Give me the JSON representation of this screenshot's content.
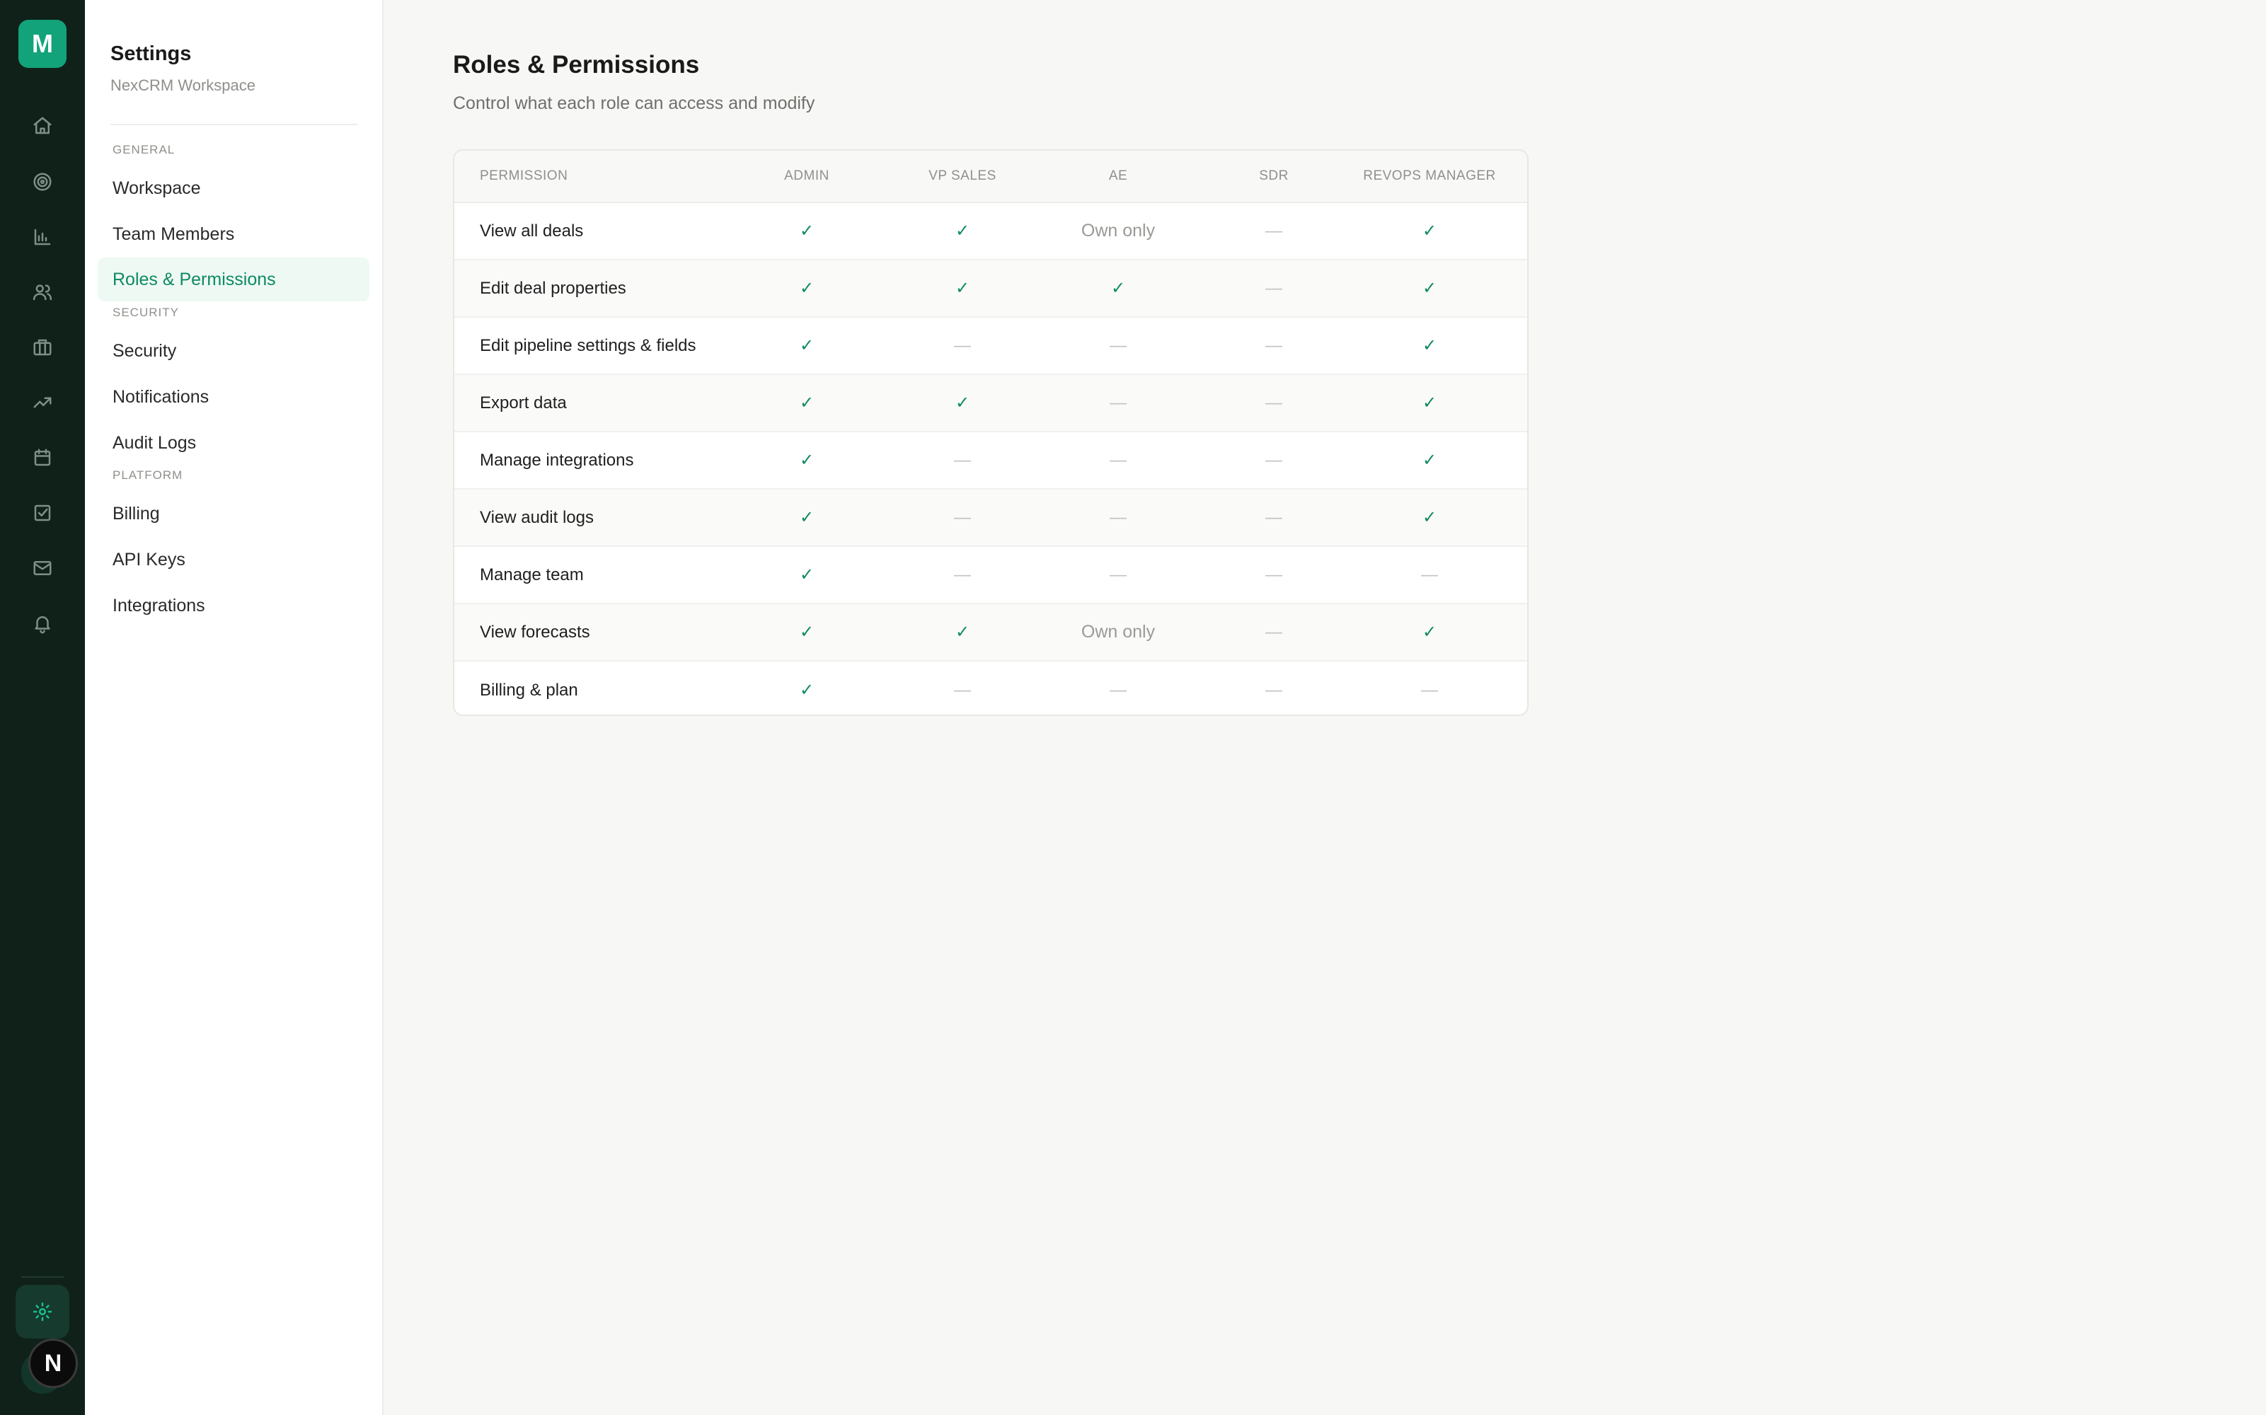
{
  "app": {
    "logo_letter": "M",
    "avatar_letter": "N"
  },
  "rail": {
    "icons": [
      "home-icon",
      "target-icon",
      "bar-chart-icon",
      "users-icon",
      "briefcase-icon",
      "trending-up-icon",
      "calendar-icon",
      "checkbox-icon",
      "mail-icon",
      "bell-icon"
    ],
    "settings_icon": "gear-icon"
  },
  "sidebar": {
    "title": "Settings",
    "subtitle": "NexCRM Workspace",
    "sections": [
      {
        "label": "GENERAL",
        "items": [
          "Workspace",
          "Team Members",
          "Roles & Permissions"
        ]
      },
      {
        "label": "SECURITY",
        "items": [
          "Security",
          "Notifications",
          "Audit Logs"
        ]
      },
      {
        "label": "PLATFORM",
        "items": [
          "Billing",
          "API Keys",
          "Integrations"
        ]
      }
    ],
    "active_item": "Roles & Permissions"
  },
  "main": {
    "title": "Roles & Permissions",
    "subtitle": "Control what each role can access and modify"
  },
  "table": {
    "columns": [
      "PERMISSION",
      "ADMIN",
      "VP SALES",
      "AE",
      "SDR",
      "REVOPS MANAGER"
    ],
    "rows": [
      {
        "permission": "View all deals",
        "values": [
          "✓",
          "✓",
          "Own only",
          "—",
          "✓"
        ]
      },
      {
        "permission": "Edit deal properties",
        "values": [
          "✓",
          "✓",
          "✓",
          "—",
          "✓"
        ]
      },
      {
        "permission": "Edit pipeline settings & fields",
        "values": [
          "✓",
          "—",
          "—",
          "—",
          "✓"
        ]
      },
      {
        "permission": "Export data",
        "values": [
          "✓",
          "✓",
          "—",
          "—",
          "✓"
        ]
      },
      {
        "permission": "Manage integrations",
        "values": [
          "✓",
          "—",
          "—",
          "—",
          "✓"
        ]
      },
      {
        "permission": "View audit logs",
        "values": [
          "✓",
          "—",
          "—",
          "—",
          "✓"
        ]
      },
      {
        "permission": "Manage team",
        "values": [
          "✓",
          "—",
          "—",
          "—",
          "—"
        ]
      },
      {
        "permission": "View forecasts",
        "values": [
          "✓",
          "✓",
          "Own only",
          "—",
          "✓"
        ]
      },
      {
        "permission": "Billing & plan",
        "values": [
          "✓",
          "—",
          "—",
          "—",
          "—"
        ]
      }
    ]
  },
  "colors": {
    "accent": "#0f8a62",
    "rail_bg": "#0f2119",
    "logo_bg": "#12a37a"
  }
}
